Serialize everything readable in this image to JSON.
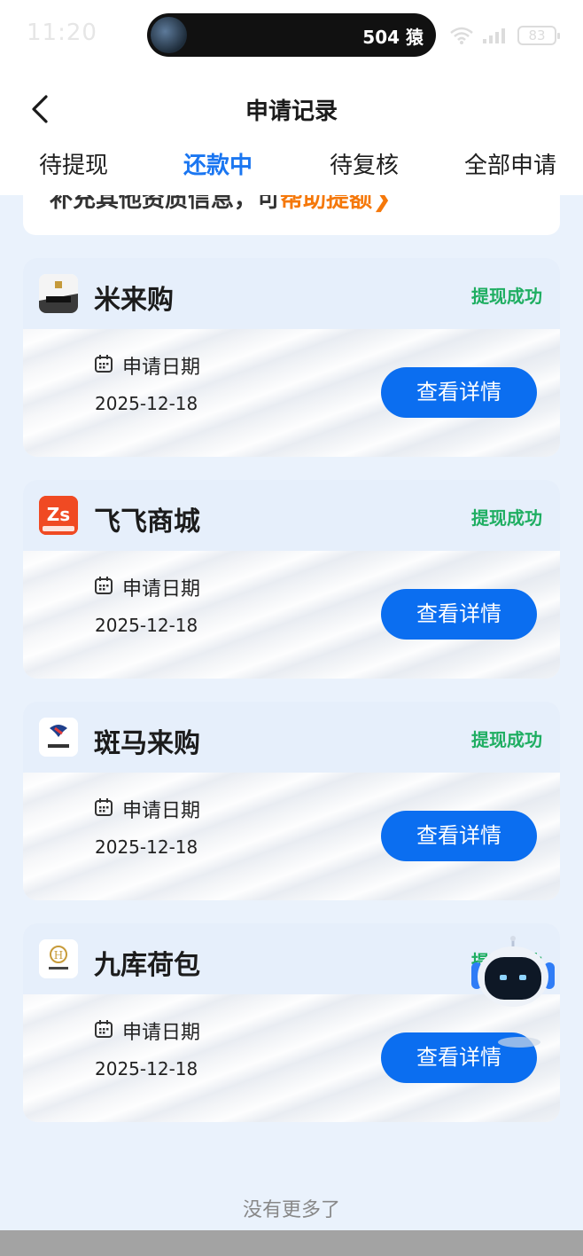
{
  "status_bar": {
    "time": "11:20",
    "island_text": "504 猿",
    "battery": "83"
  },
  "nav": {
    "title": "申请记录"
  },
  "tabs": [
    {
      "label": "待提现"
    },
    {
      "label": "还款中"
    },
    {
      "label": "待复核"
    },
    {
      "label": "全部申请"
    }
  ],
  "notice": {
    "text": "补充其他资质信息，可",
    "link": "帮助提额"
  },
  "records": [
    {
      "merchant": "米来购",
      "status": "提现成功",
      "date_label": "申请日期",
      "date": "2025-12-18",
      "button": "查看详情",
      "logo_icon": "milaigou-logo-icon"
    },
    {
      "merchant": "飞飞商城",
      "status": "提现成功",
      "date_label": "申请日期",
      "date": "2025-12-18",
      "button": "查看详情",
      "logo_icon": "feifei-logo-icon"
    },
    {
      "merchant": "斑马来购",
      "status": "提现成功",
      "date_label": "申请日期",
      "date": "2025-12-18",
      "button": "查看详情",
      "logo_icon": "banma-logo-icon"
    },
    {
      "merchant": "九库荷包",
      "status": "提现成功",
      "date_label": "申请日期",
      "date": "2025-12-18",
      "button": "查看详情",
      "logo_icon": "jiuku-logo-icon"
    }
  ],
  "footer": {
    "text": "没有更多了"
  },
  "colors": {
    "accent": "#1a76f1",
    "button": "#0b6ef0",
    "success": "#1fae62",
    "link": "#f5780a"
  }
}
